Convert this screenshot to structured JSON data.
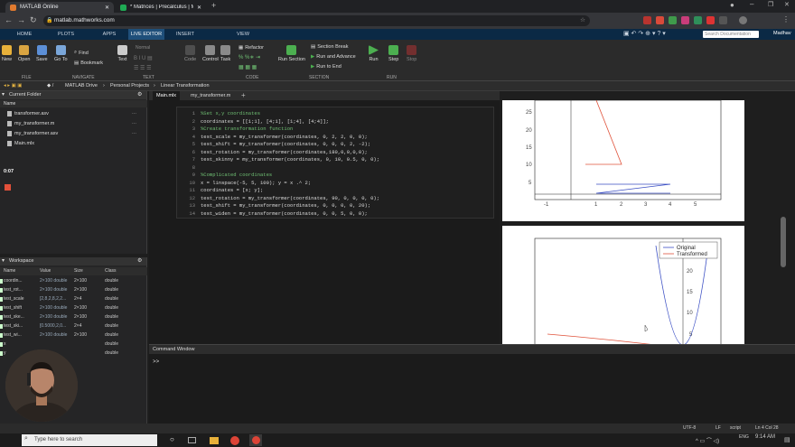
{
  "browser": {
    "tabs": [
      {
        "title": "MATLAB Online",
        "active": true
      },
      {
        "title": "* Matrices | Precalculus | Math |",
        "active": false
      }
    ],
    "new_tab": "+",
    "url": "matlab.mathworks.com"
  },
  "matlab_tabs": [
    "HOME",
    "PLOTS",
    "APPS",
    "LIVE EDITOR",
    "INSERT",
    "VIEW"
  ],
  "active_tab": "LIVE EDITOR",
  "search_placeholder": "Search Documentation",
  "user": "Madhav",
  "ribbon": {
    "file": {
      "section": "FILE",
      "new": "New",
      "open": "Open",
      "save": "Save"
    },
    "navigate": {
      "section": "NAVIGATE",
      "goto": "Go To",
      "find": "Find",
      "bookmark": "Bookmark"
    },
    "text": {
      "section": "TEXT",
      "text": "Text",
      "normal": "Normal"
    },
    "code": {
      "section": "CODE",
      "code": "Code",
      "control": "Control",
      "task": "Task",
      "refactor": "Refactor"
    },
    "section": {
      "section": "SECTION",
      "section_break": "Section Break",
      "run_advance": "Run and Advance",
      "run_to_end": "Run to End",
      "run_section": "Run Section"
    },
    "run": {
      "section": "RUN",
      "run": "Run",
      "step": "Step",
      "stop": "Stop"
    }
  },
  "path": [
    "MATLAB Drive",
    "Personal Projects",
    "Linear Transformation"
  ],
  "current_folder": {
    "title": "Current Folder",
    "name_col": "Name",
    "files": [
      "transformer.asv",
      "my_transformer.m",
      "my_transformer.asv",
      "Main.mlx"
    ],
    "elapsed": "0:07"
  },
  "workspace": {
    "title": "Workspace",
    "columns": [
      "Name",
      "Value",
      "Size",
      "Class"
    ],
    "rows": [
      {
        "name": "coordin...",
        "value": "2×100 double",
        "size": "2×100",
        "cls": "double"
      },
      {
        "name": "test_rot...",
        "value": "2×100 double",
        "size": "2×100",
        "cls": "double"
      },
      {
        "name": "test_scale",
        "value": "[2,8,2,8,2,2...",
        "size": "2×4",
        "cls": "double"
      },
      {
        "name": "test_shift",
        "value": "2×100 double",
        "size": "2×100",
        "cls": "double"
      },
      {
        "name": "test_ske...",
        "value": "2×100 double",
        "size": "2×100",
        "cls": "double"
      },
      {
        "name": "test_ski...",
        "value": "[0.5000,2,0...",
        "size": "2×4",
        "cls": "double"
      },
      {
        "name": "test_wi...",
        "value": "2×100 double",
        "size": "2×100",
        "cls": "double"
      },
      {
        "name": "x",
        "value": "",
        "size": "",
        "cls": "double"
      },
      {
        "name": "y",
        "value": "",
        "size": "",
        "cls": "double"
      }
    ]
  },
  "editor": {
    "tabs": [
      "Main.mlx",
      "my_transformer.m"
    ],
    "lines": [
      {
        "n": "1",
        "t": "%Set x,y coordinates",
        "c": true
      },
      {
        "n": "2",
        "t": "coordinates = [[1;1], [4;1], [1;4], [4;4]];",
        "c": false
      },
      {
        "n": "3",
        "t": "%Create transformation function",
        "c": true
      },
      {
        "n": "4",
        "t": "test_scale = my_transformer(coordinates, 0, 2, 2, 0, 0);",
        "c": false
      },
      {
        "n": "5",
        "t": "test_shift = my_transformer(coordinates, 0, 0, 0, 2, -2);",
        "c": false
      },
      {
        "n": "6",
        "t": "test_rotation = my_transformer(coordinates,180,0,0,0,0);",
        "c": false
      },
      {
        "n": "7",
        "t": "test_skinny = my_transformer(coordinates, 0, 10, 0.5, 0, 0);",
        "c": false
      },
      {
        "n": "8",
        "t": "",
        "c": false
      },
      {
        "n": "9",
        "t": "%Complicated coordinates",
        "c": true
      },
      {
        "n": "10",
        "t": "x = linspace(-5, 5, 100); y = x .^ 2;",
        "c": false
      },
      {
        "n": "11",
        "t": "coordinates = [x; y];",
        "c": false
      },
      {
        "n": "12",
        "t": "test_rotation = my_transformer(coordinates, 90, 0, 0, 0, 0);",
        "c": false
      },
      {
        "n": "13",
        "t": "test_shift = my_transformer(coordinates, 0, 0, 0, 0, 20);",
        "c": false
      },
      {
        "n": "14",
        "t": "test_widen = my_transformer(coordinates, 0, 0, 5, 0, 0);",
        "c": false
      }
    ]
  },
  "plot1": {
    "yticks": [
      "25",
      "20",
      "15",
      "10",
      "5"
    ],
    "xticks": [
      "-1",
      "1",
      "2",
      "3",
      "4",
      "5"
    ]
  },
  "plot2": {
    "yticks": [
      "20",
      "15",
      "10",
      "5"
    ],
    "legend": [
      "Original",
      "Transformed"
    ]
  },
  "command_window": {
    "title": "Command Window",
    "prompt": ">>"
  },
  "status": {
    "encoding": "UTF-8",
    "eol": "LF",
    "type": "script",
    "pos": "Ln 4  Col 28"
  },
  "taskbar": {
    "search_placeholder": "Type here to search",
    "lang": "ENG",
    "time": "9:14 AM"
  },
  "colors": {
    "accent": "#1f4f7a",
    "comment": "#6fbf73",
    "original": "#3b4fc4",
    "transformed": "#e0533b"
  }
}
